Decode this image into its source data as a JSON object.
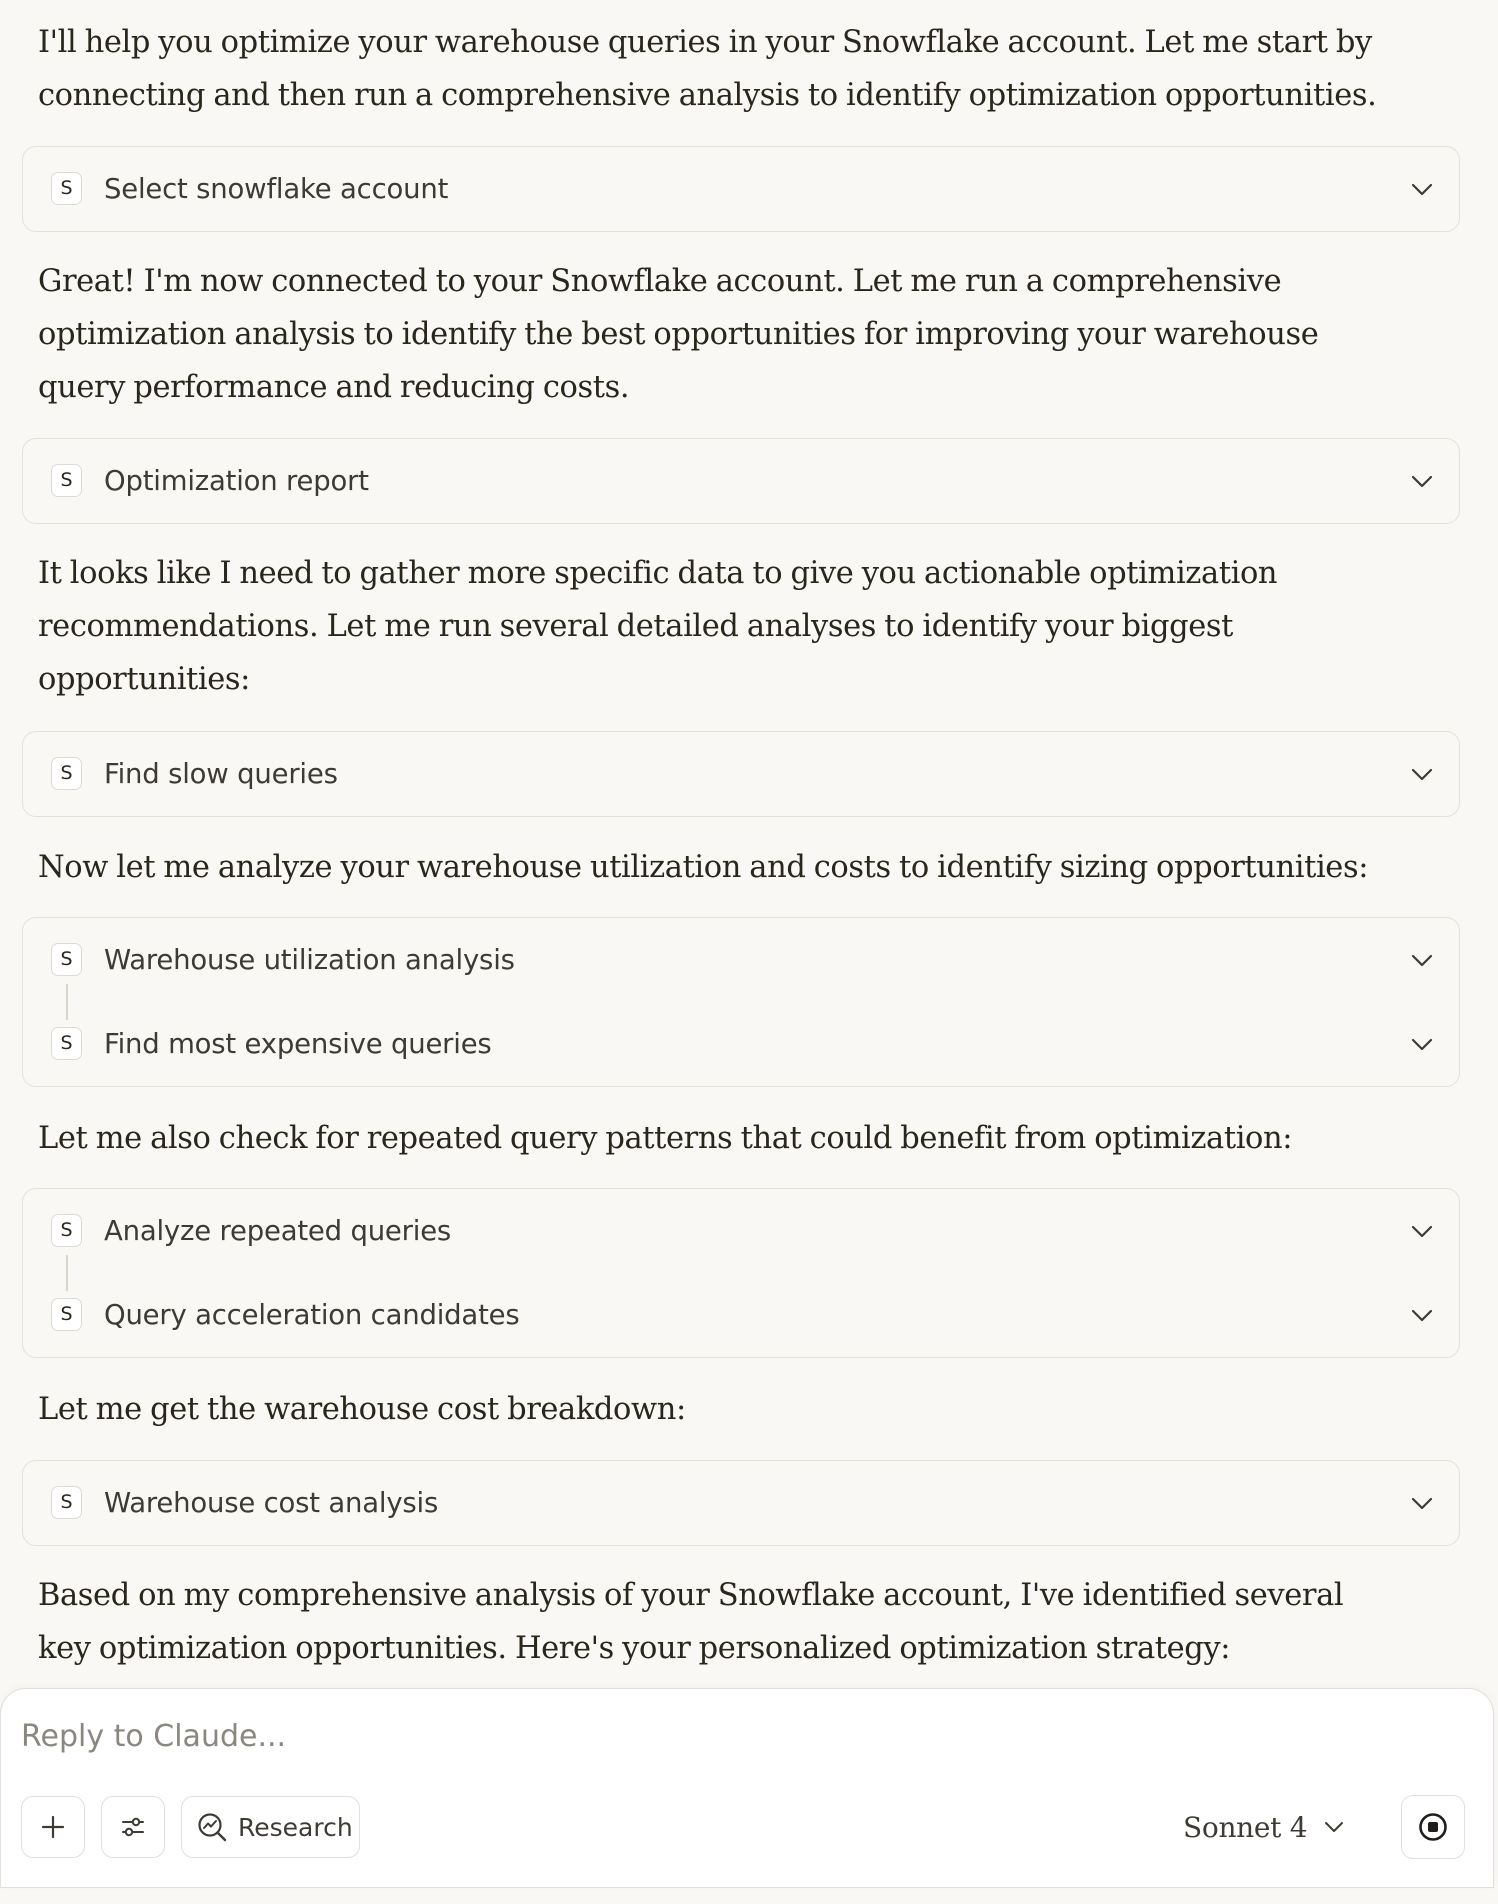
{
  "messages": [
    {
      "type": "text",
      "lines": [
        "I'll help you optimize your warehouse queries in your Snowflake account. Let me start by",
        "connecting and then run a comprehensive analysis to identify optimization opportunities."
      ]
    },
    {
      "type": "tools",
      "items": [
        {
          "badge": "S",
          "label": "Select snowflake account"
        }
      ]
    },
    {
      "type": "text",
      "lines": [
        "Great! I'm now connected to your Snowflake account. Let me run a comprehensive",
        "optimization analysis to identify the best opportunities for improving your warehouse",
        "query performance and reducing costs."
      ]
    },
    {
      "type": "tools",
      "items": [
        {
          "badge": "S",
          "label": "Optimization report"
        }
      ]
    },
    {
      "type": "text",
      "lines": [
        "It looks like I need to gather more specific data to give you actionable optimization",
        "recommendations. Let me run several detailed analyses to identify your biggest",
        "opportunities:"
      ]
    },
    {
      "type": "tools",
      "items": [
        {
          "badge": "S",
          "label": "Find slow queries"
        }
      ]
    },
    {
      "type": "text",
      "lines": [
        "Now let me analyze your warehouse utilization and costs to identify sizing opportunities:"
      ]
    },
    {
      "type": "tools",
      "items": [
        {
          "badge": "S",
          "label": "Warehouse utilization analysis"
        },
        {
          "badge": "S",
          "label": "Find most expensive queries"
        }
      ]
    },
    {
      "type": "text",
      "lines": [
        "Let me also check for repeated query patterns that could benefit from optimization:"
      ]
    },
    {
      "type": "tools",
      "items": [
        {
          "badge": "S",
          "label": "Analyze repeated queries"
        },
        {
          "badge": "S",
          "label": "Query acceleration candidates"
        }
      ]
    },
    {
      "type": "text",
      "lines": [
        "Let me get the warehouse cost breakdown:"
      ]
    },
    {
      "type": "tools",
      "items": [
        {
          "badge": "S",
          "label": "Warehouse cost analysis"
        }
      ]
    },
    {
      "type": "text",
      "lines": [
        "Based on my comprehensive analysis of your Snowflake account, I've identified several",
        "key optimization opportunities. Here's your personalized optimization strategy:"
      ]
    }
  ],
  "composer": {
    "placeholder": "Reply to Claude...",
    "research_label": "Research",
    "model_label": "Sonnet 4"
  },
  "icons": {
    "add": "plus-icon",
    "tools": "sliders-icon",
    "research": "research-icon",
    "chevron": "chevron-down-icon",
    "stop": "stop-icon"
  }
}
